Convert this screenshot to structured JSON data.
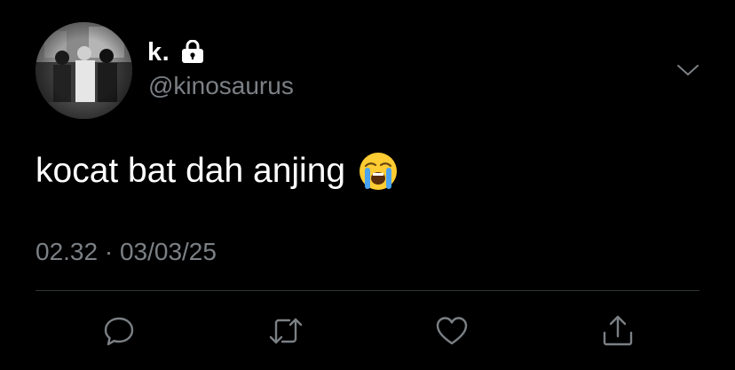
{
  "tweet": {
    "display_name": "k.",
    "handle": "@kinosaurus",
    "text": "kocat bat dah anjing",
    "emoji": "loudly-crying-face",
    "timestamp": "02.32 · 03/03/25"
  },
  "icons": {
    "verified_lock": "lock-icon",
    "menu": "chevron-down-icon",
    "reply": "reply-icon",
    "retweet": "retweet-icon",
    "like": "heart-icon",
    "share": "share-icon"
  },
  "colors": {
    "background": "#000000",
    "text": "#ffffff",
    "muted": "#7b8085",
    "divider": "#2f3336"
  }
}
